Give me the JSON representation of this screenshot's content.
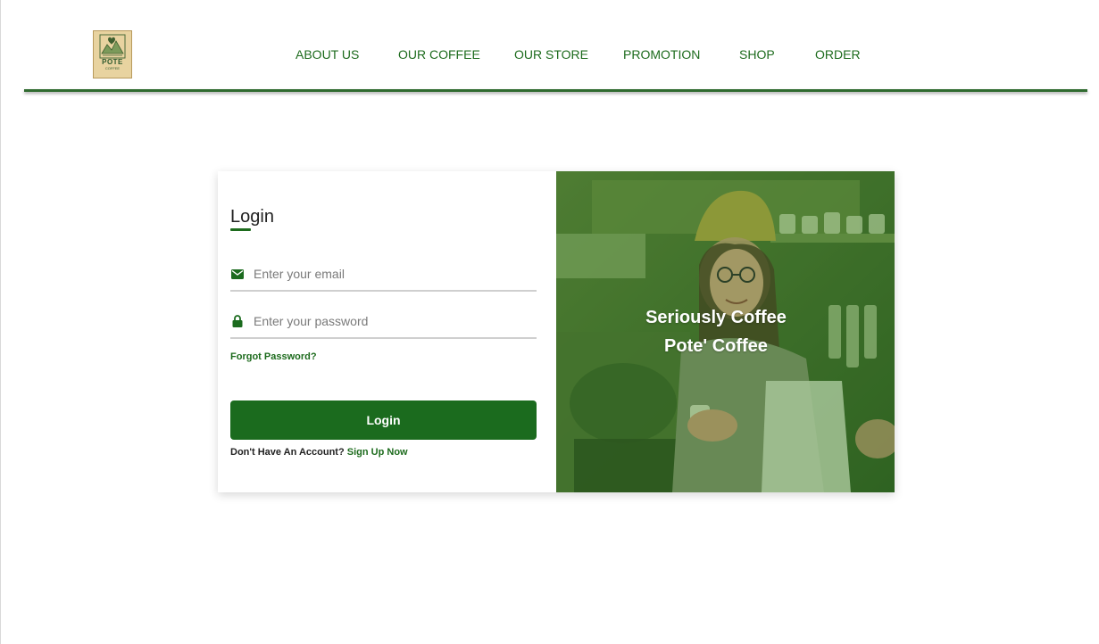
{
  "nav": {
    "items": [
      {
        "label": "ABOUT US"
      },
      {
        "label": "OUR COFFEE"
      },
      {
        "label": "OUR STORE"
      },
      {
        "label": "PROMOTION"
      },
      {
        "label": "SHOP"
      },
      {
        "label": "ORDER"
      }
    ]
  },
  "brand": {
    "logo_text": "POTE",
    "logo_subtext": "COFFEE",
    "primary_color": "#1b6b1e",
    "logo_background": "#e8d3a0"
  },
  "login": {
    "title": "Login",
    "email_placeholder": "Enter your email",
    "email_value": "",
    "email_icon": "envelope-icon",
    "password_placeholder": "Enter your password",
    "password_value": "",
    "password_icon": "lock-icon",
    "forgot_label": "Forgot Password?",
    "button_label": "Login",
    "no_account_text": "Don't Have An Account?",
    "signup_label": "Sign Up Now"
  },
  "hero": {
    "line1": "Seriously Coffee",
    "line2": "Pote' Coffee",
    "overlay_color": "#3f7a2a"
  }
}
